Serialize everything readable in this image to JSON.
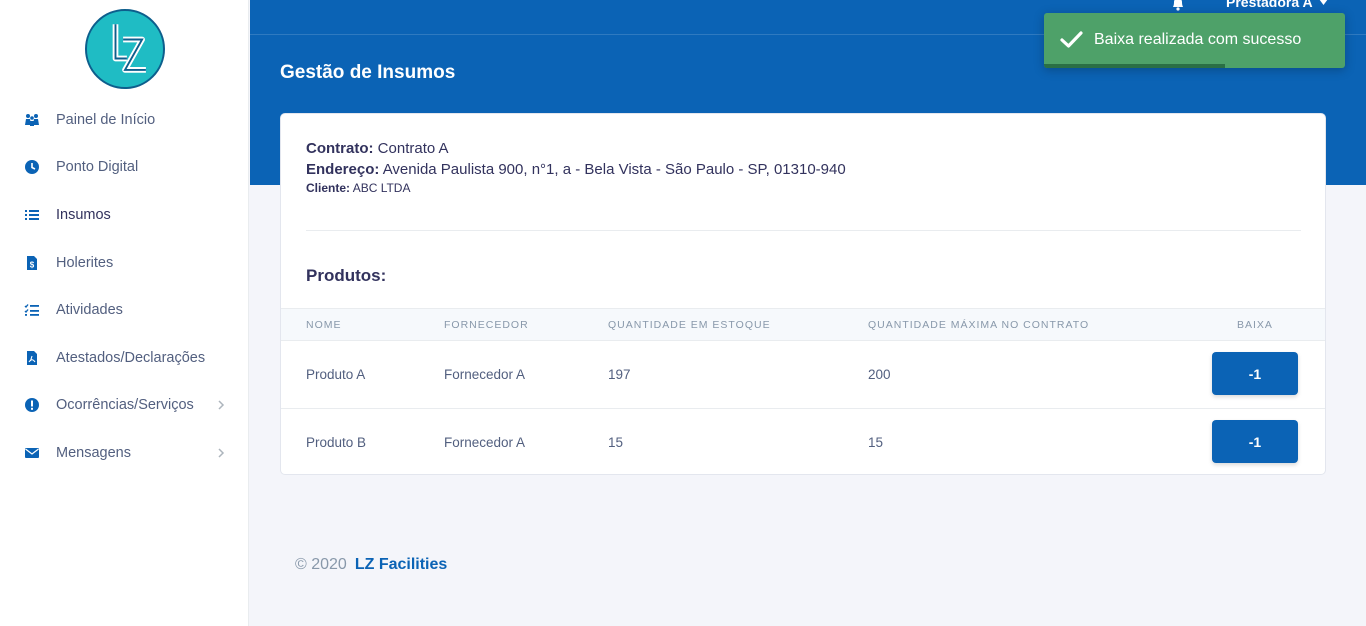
{
  "logo": {
    "text": "LZ"
  },
  "sidebar": {
    "items": [
      {
        "label": "Painel de Início",
        "icon": "people-icon"
      },
      {
        "label": "Ponto Digital",
        "icon": "clock-icon"
      },
      {
        "label": "Insumos",
        "icon": "list-icon"
      },
      {
        "label": "Holerites",
        "icon": "dollar-file-icon"
      },
      {
        "label": "Atividades",
        "icon": "task-list-icon"
      },
      {
        "label": "Atestados/Declarações",
        "icon": "pdf-file-icon"
      },
      {
        "label": "Ocorrências/Serviços",
        "icon": "exclamation-circle-icon",
        "has_submenu": true
      },
      {
        "label": "Mensagens",
        "icon": "envelope-icon",
        "has_submenu": true
      }
    ]
  },
  "header": {
    "user_name": "Prestadora A",
    "page_title": "Gestão de Insumos"
  },
  "toast": {
    "message": "Baixa realizada com sucesso",
    "progress": 0.6
  },
  "contract": {
    "contract_label": "Contrato:",
    "contract_value": "Contrato A",
    "address_label": "Endereço:",
    "address_value": "Avenida Paulista 900, n°1, a - Bela Vista - São Paulo - SP, 01310-940",
    "client_label": "Cliente:",
    "client_value": "ABC LTDA"
  },
  "products": {
    "title": "Produtos:",
    "columns": [
      "NOME",
      "FORNECEDOR",
      "QUANTIDADE EM ESTOQUE",
      "QUANTIDADE MÁXIMA NO CONTRATO",
      "BAIXA"
    ],
    "rows": [
      {
        "name": "Produto A",
        "supplier": "Fornecedor A",
        "stock": "197",
        "max": "200",
        "action": "-1"
      },
      {
        "name": "Produto B",
        "supplier": "Fornecedor A",
        "stock": "15",
        "max": "15",
        "action": "-1"
      }
    ]
  },
  "footer": {
    "copyright": "© 2020",
    "brand": "LZ Facilities"
  },
  "colors": {
    "primary": "#0b63b5",
    "toast": "#4ea169",
    "logo": "#1fbcc4"
  }
}
